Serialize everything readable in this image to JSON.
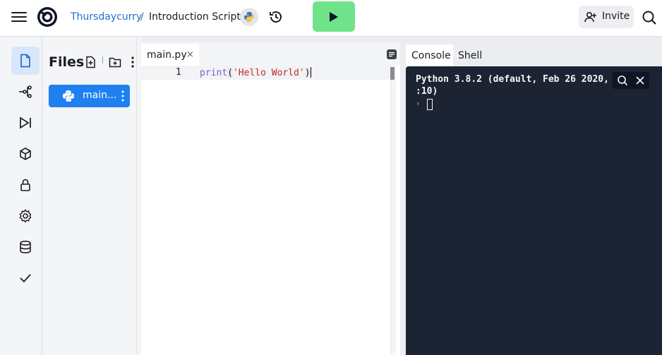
{
  "header": {
    "user": "Thursdaycurry",
    "separator": "/",
    "project": "Introduction Script",
    "invite_label": "Invite",
    "run_color": "#6fe38a",
    "accent": "#1f80f0"
  },
  "sidebar": {
    "items": [
      "files-icon",
      "version-control-icon",
      "debugger-icon",
      "packages-icon",
      "secrets-icon",
      "settings-icon",
      "database-icon",
      "unit-tests-icon"
    ]
  },
  "files_panel": {
    "title": "Files",
    "files": [
      {
        "label": "main..."
      }
    ]
  },
  "editor": {
    "tab_label": "main.py",
    "tab_close": "×",
    "line_number": "1",
    "code": {
      "fn": "print",
      "open": "(",
      "str": "'Hello World'",
      "close": ")"
    }
  },
  "console": {
    "tabs": [
      "Console",
      "Shell"
    ],
    "output": "Python 3.8.2 (default, Feb 26 2020, 02:56:10)",
    "output_visible_line1": "Python 3.8.2 (default, Feb 26 2020,",
    "output_visible_line2": ":10)",
    "prompt": "›",
    "bg_color": "#1c2333"
  }
}
